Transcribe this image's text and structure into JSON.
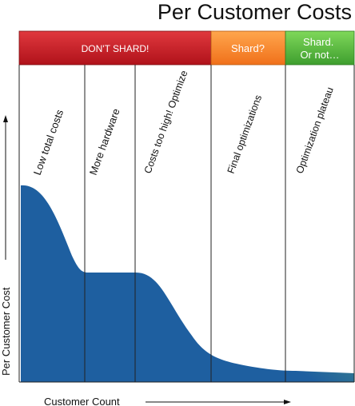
{
  "title": "Per Customer Costs",
  "bands": [
    {
      "label": "DON'T SHARD!",
      "color_top": "#e0383e",
      "color_bottom": "#b0121a"
    },
    {
      "label": "Shard?",
      "color_top": "#ffa64d",
      "color_bottom": "#f0701a"
    },
    {
      "label": "Shard.\nOr not…",
      "color_top": "#7fd85a",
      "color_bottom": "#3e9e2e"
    }
  ],
  "phases": [
    "Low total costs",
    "More hardware",
    "Costs too high! Optimize",
    "Final optimizations",
    "Optimization plateau"
  ],
  "y_axis_label": "Per Customer Cost",
  "x_axis_label": "Customer Count",
  "colors": {
    "area_dark": "#1e5fa0",
    "area_light": "#7ccf5a",
    "line": "#222222"
  }
}
